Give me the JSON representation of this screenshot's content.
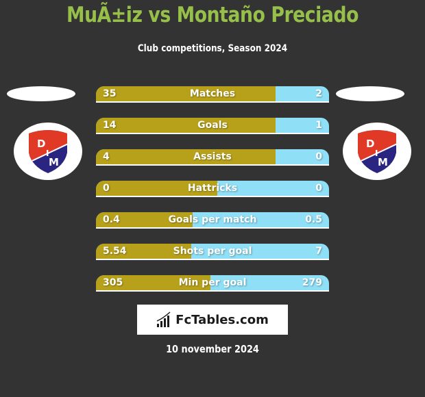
{
  "header": {
    "title": "MuÃ±iz vs Montaño Preciado",
    "subtitle": "Club competitions, Season 2024"
  },
  "players": {
    "left": {
      "logo_text_top": "D",
      "logo_text_mid": "I",
      "logo_text_bottom": "M",
      "logo_icon": "dim-club-crest-icon"
    },
    "right": {
      "logo_text_top": "D",
      "logo_text_mid": "I",
      "logo_text_bottom": "M",
      "logo_icon": "dim-club-crest-icon"
    }
  },
  "colors": {
    "title": "#97c04a",
    "left_bar": "#b8a11a",
    "right_bar": "#8fdff6",
    "background": "#333333"
  },
  "stats": [
    {
      "label": "Matches",
      "left": "35",
      "right": "2",
      "left_share": 0.77
    },
    {
      "label": "Goals",
      "left": "14",
      "right": "1",
      "left_share": 0.77
    },
    {
      "label": "Assists",
      "left": "4",
      "right": "0",
      "left_share": 0.77
    },
    {
      "label": "Hattricks",
      "left": "0",
      "right": "0",
      "left_share": 0.52
    },
    {
      "label": "Goals per match",
      "left": "0.4",
      "right": "0.5",
      "left_share": 0.415
    },
    {
      "label": "Shots per goal",
      "left": "5.54",
      "right": "7",
      "left_share": 0.41
    },
    {
      "label": "Min per goal",
      "left": "305",
      "right": "279",
      "left_share": 0.49
    }
  ],
  "footer": {
    "brand": "FcTables.com",
    "brand_icon": "bar-chart-icon",
    "date": "10 november 2024"
  }
}
